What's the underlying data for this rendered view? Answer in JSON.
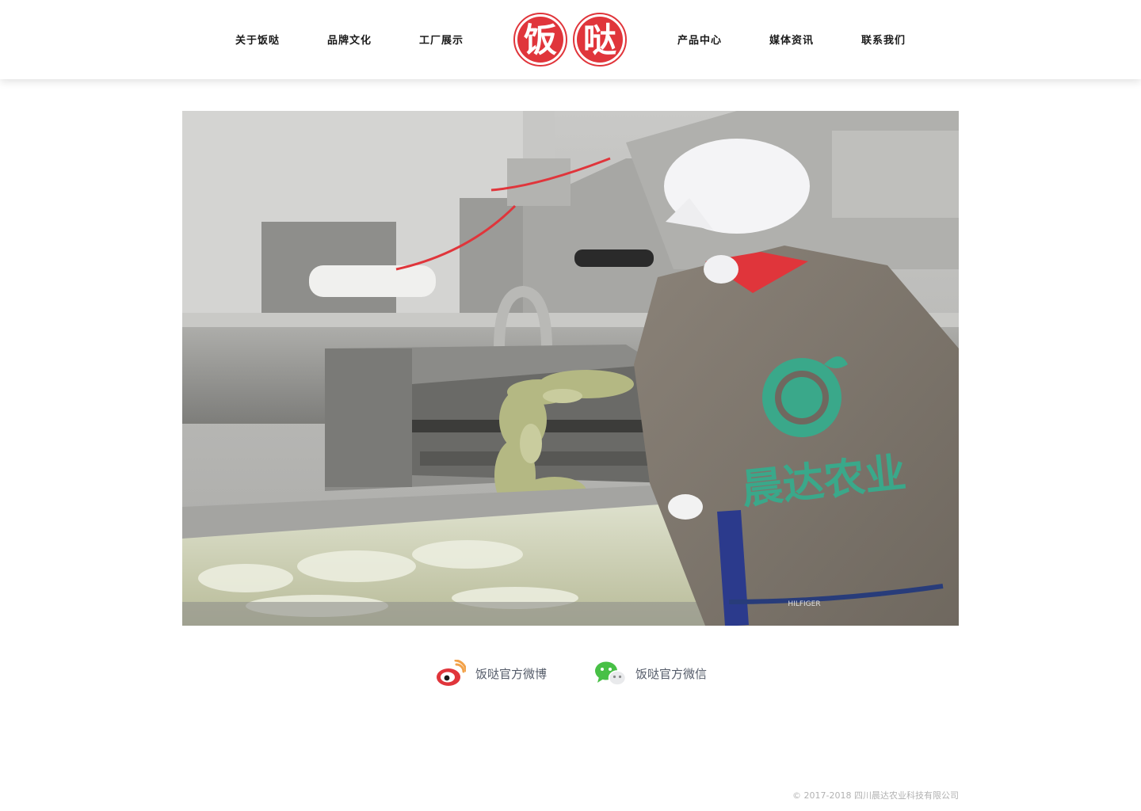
{
  "nav": {
    "left": [
      "关于饭哒",
      "品牌文化",
      "工厂展示"
    ],
    "right": [
      "产品中心",
      "媒体资讯",
      "联系我们"
    ]
  },
  "logo": {
    "chars": [
      "饭",
      "哒"
    ],
    "color": "#e0353b"
  },
  "hero": {
    "jacket_text": "晨达农业",
    "apron_text": "HILFIGER"
  },
  "social": {
    "weibo": {
      "label": "饭哒官方微博",
      "icon": "weibo-icon"
    },
    "wechat": {
      "label": "饭哒官方微信",
      "icon": "wechat-icon"
    }
  },
  "footer": {
    "copyright": "© 2017-2018 四川晨达农业科技有限公司"
  }
}
